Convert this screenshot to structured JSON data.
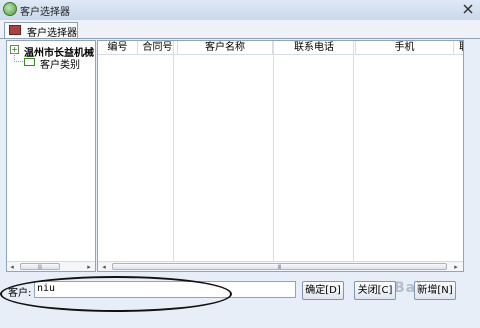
{
  "window": {
    "title": "客户选择器"
  },
  "tabs": [
    {
      "label": "客户选择器"
    }
  ],
  "tree": {
    "root": {
      "label": "温州市长益机械",
      "expander": "+"
    },
    "child": {
      "label": "客户类别"
    }
  },
  "grid": {
    "columns": [
      "编号",
      "合同号",
      "客户名称",
      "联系电话",
      "手机",
      "联"
    ]
  },
  "scroll": {
    "grip": "Ⅲ",
    "left": "◂",
    "right": "▸"
  },
  "customer": {
    "label": "客户:",
    "value": "niu"
  },
  "buttons": {
    "ok": "确定[D]",
    "close": "关闭[C]",
    "new": "新增[N]"
  },
  "watermark": {
    "text": "Bai"
  }
}
